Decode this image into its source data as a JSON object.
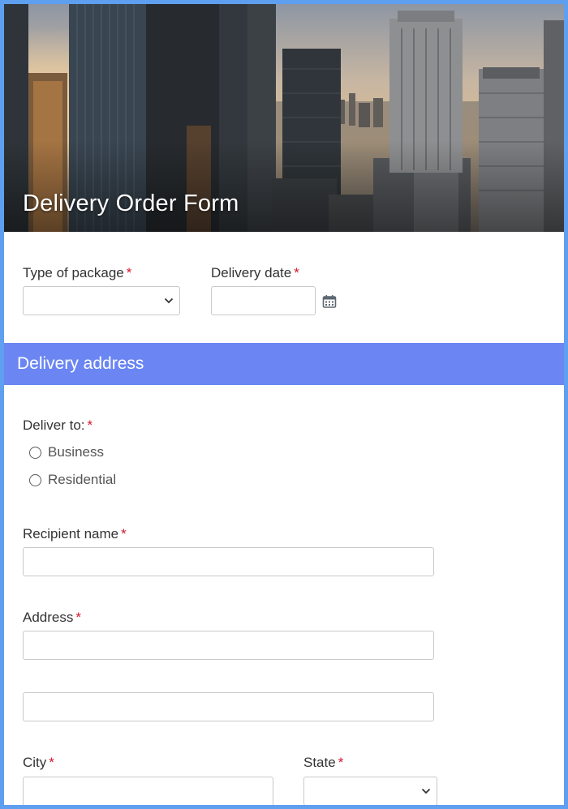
{
  "form": {
    "title": "Delivery Order Form",
    "required_marker": "*"
  },
  "fields": {
    "package_type": {
      "label": "Type of package",
      "value": ""
    },
    "delivery_date": {
      "label": "Delivery date",
      "value": ""
    },
    "deliver_to": {
      "label": "Deliver to:",
      "options": [
        "Business",
        "Residential"
      ]
    },
    "recipient_name": {
      "label": "Recipient name",
      "value": ""
    },
    "address": {
      "label": "Address",
      "line1": "",
      "line2": ""
    },
    "city": {
      "label": "City",
      "value": ""
    },
    "state": {
      "label": "State",
      "value": ""
    }
  },
  "sections": {
    "delivery_address": "Delivery address"
  },
  "colors": {
    "border": "#5e9ff0",
    "section_bg": "#6b86f2",
    "required": "#d3162a"
  },
  "icons": {
    "date_picker": "calendar-icon",
    "select": "chevron-down-icon"
  }
}
